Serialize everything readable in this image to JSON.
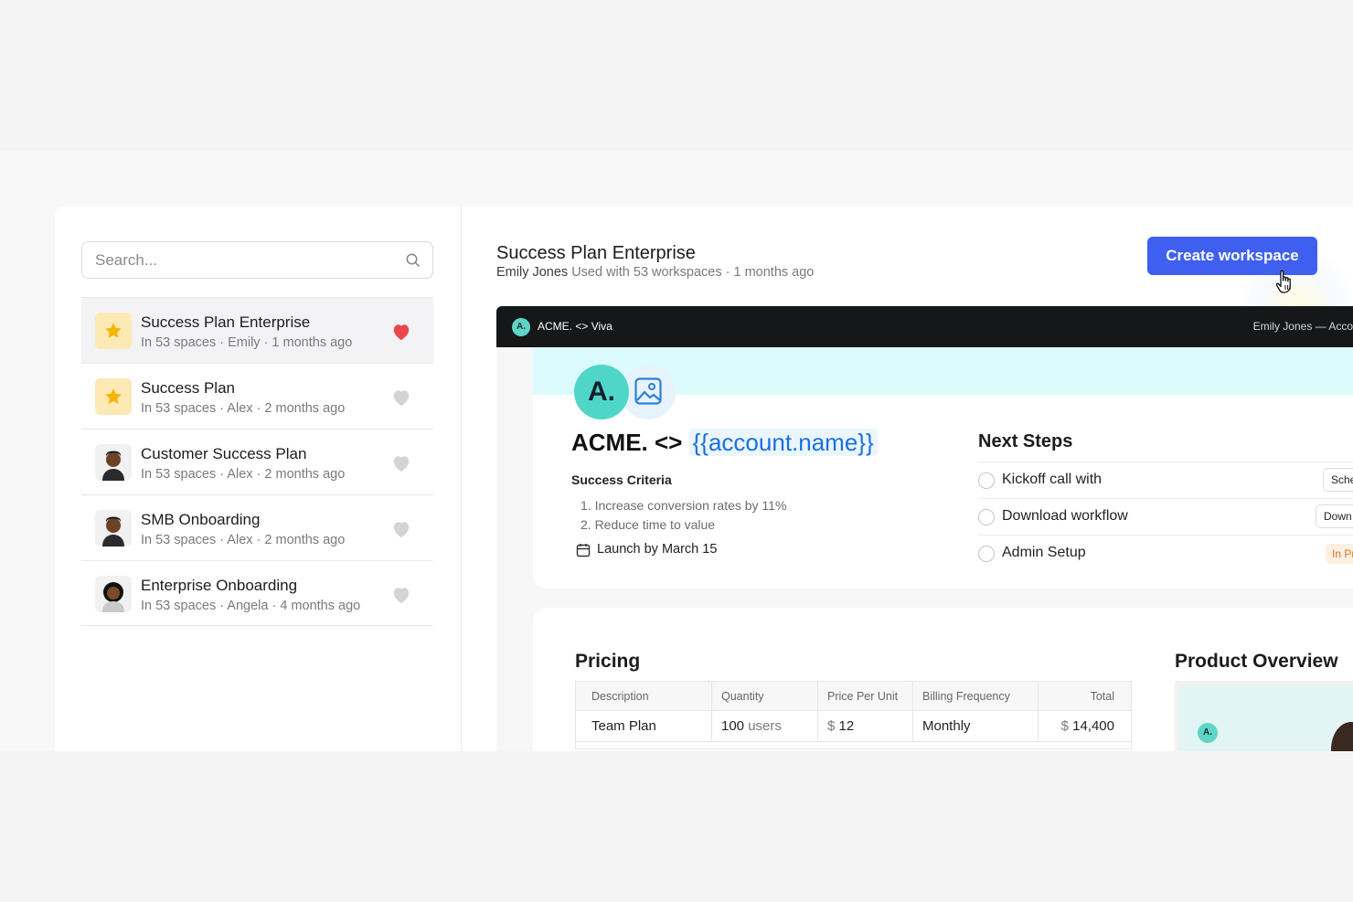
{
  "search": {
    "placeholder": "Search..."
  },
  "templates": [
    {
      "title": "Success Plan Enterprise",
      "meta": "In 53 spaces · Emily · 1 months ago",
      "favorite": true,
      "thumb": "star-icon"
    },
    {
      "title": "Success Plan",
      "meta": "In 53 spaces · Alex · 2 months ago",
      "favorite": false,
      "thumb": "star-icon"
    },
    {
      "title": "Customer Success Plan",
      "meta": "In 53 spaces · Alex · 2 months ago",
      "favorite": false,
      "thumb": "avatar"
    },
    {
      "title": "SMB Onboarding",
      "meta": "In 53 spaces · Alex · 2 months ago",
      "favorite": false,
      "thumb": "avatar"
    },
    {
      "title": "Enterprise Onboarding",
      "meta": "In 53 spaces · Angela · 4 months ago",
      "favorite": false,
      "thumb": "avatar"
    }
  ],
  "detail": {
    "title": "Success Plan Enterprise",
    "author": "Emily Jones",
    "usage": "Used with 53 workspaces · 1 months ago",
    "create_button": "Create workspace"
  },
  "preview": {
    "bar_logo": "A.",
    "bar_title": "ACME. <> Viva",
    "bar_right": "Emily Jones — Acco",
    "logo_text": "A.",
    "headline_prefix": "ACME. <>",
    "headline_token": "{{account.name}}",
    "success_criteria_title": "Success Criteria",
    "success_criteria": [
      "1.  Increase conversion rates by 11%",
      "2.  Reduce time to value"
    ],
    "launch": "Launch by March 15",
    "next_steps_title": "Next Steps",
    "next_steps": [
      {
        "label": "Kickoff call with",
        "action": "Sche"
      },
      {
        "label": "Download workflow",
        "action": "Down"
      },
      {
        "label": "Admin Setup",
        "status": "In Pr"
      }
    ],
    "pricing_title": "Pricing",
    "pricing_headers": [
      "Description",
      "Quantity",
      "Price Per Unit",
      "Billing Frequency",
      "Total"
    ],
    "pricing_rows": [
      {
        "description": "Team Plan",
        "quantity": "100",
        "quantity_unit": "users",
        "currency": "$",
        "price": "12",
        "frequency": "Monthly",
        "total": "14,400"
      }
    ],
    "product_overview_title": "Product Overview",
    "product_logo": "A."
  },
  "colors": {
    "accent": "#3f5ff0",
    "favorite": "#e8474c",
    "token": "#1b6fe0",
    "brand_teal": "#4fd6c9"
  }
}
